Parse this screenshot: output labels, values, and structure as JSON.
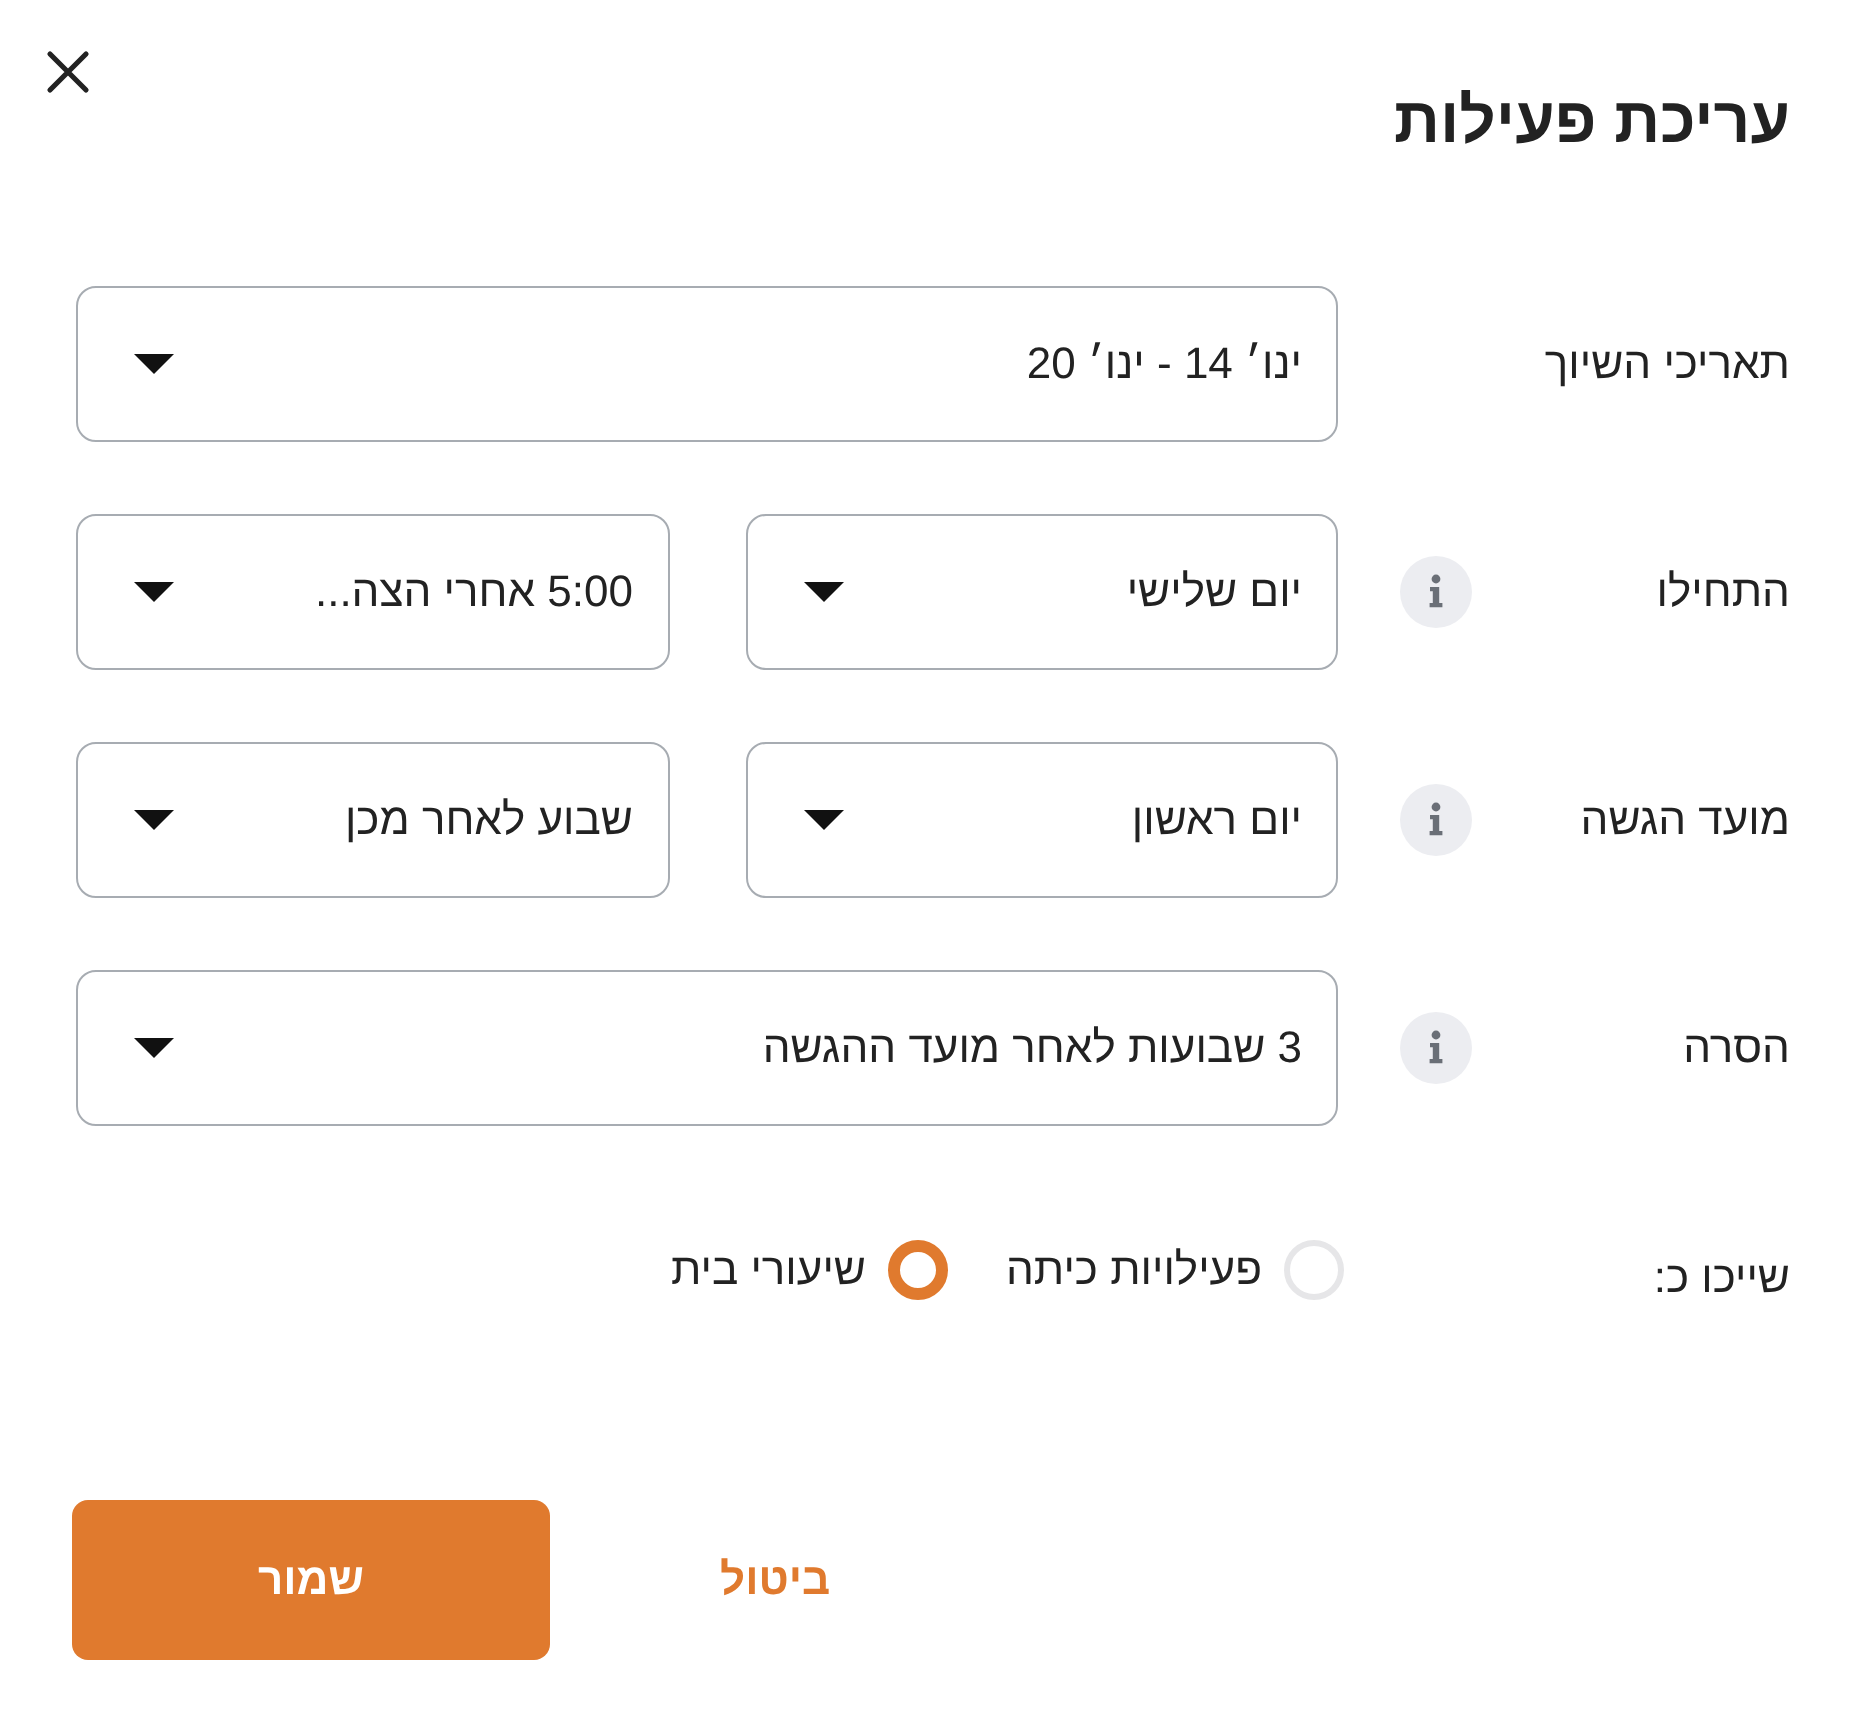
{
  "dialog": {
    "title": "עריכת פעילות"
  },
  "fields": [
    {
      "label": "תאריכי השיוך",
      "info": false,
      "selects": [
        {
          "value": "ינו׳ 14 - ינו׳ 20"
        }
      ]
    },
    {
      "label": "התחילו",
      "info": true,
      "selects": [
        {
          "value": "יום שלישי"
        },
        {
          "value": "5:00 אחרי הצה..."
        }
      ]
    },
    {
      "label": "מועד הגשה",
      "info": true,
      "selects": [
        {
          "value": "יום ראשון"
        },
        {
          "value": "שבוע לאחר מכן"
        }
      ]
    },
    {
      "label": "הסרה",
      "info": true,
      "selects": [
        {
          "value": "3 שבועות לאחר מועד ההגשה"
        }
      ]
    }
  ],
  "assign_as": {
    "label": "שייכו כ:",
    "options": [
      {
        "label": "פעילויות כיתה",
        "selected": false
      },
      {
        "label": "שיעורי בית",
        "selected": true
      }
    ]
  },
  "buttons": [
    {
      "kind": "secondary",
      "label": "ביטול"
    },
    {
      "kind": "primary",
      "label": "שמור"
    }
  ]
}
